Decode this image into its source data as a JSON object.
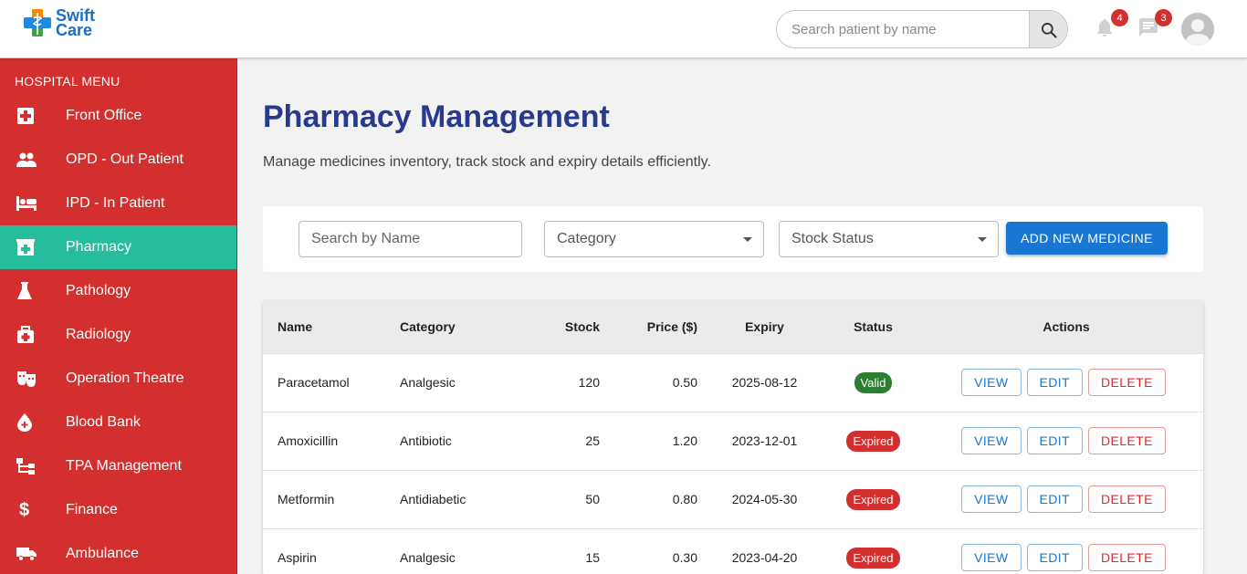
{
  "header": {
    "logo_line1": "Swift",
    "logo_line2": "Care",
    "search_placeholder": "Search patient by name",
    "notifications_count": "4",
    "messages_count": "3"
  },
  "sidebar": {
    "title": "HOSPITAL MENU",
    "items": [
      {
        "label": "Front Office",
        "icon": "first-aid-icon"
      },
      {
        "label": "OPD - Out Patient",
        "icon": "people-icon"
      },
      {
        "label": "IPD - In Patient",
        "icon": "bed-icon"
      },
      {
        "label": "Pharmacy",
        "icon": "pharmacy-icon",
        "active": true
      },
      {
        "label": "Pathology",
        "icon": "flask-icon"
      },
      {
        "label": "Radiology",
        "icon": "medical-bag-icon"
      },
      {
        "label": "Operation Theatre",
        "icon": "theatre-masks-icon"
      },
      {
        "label": "Blood Bank",
        "icon": "blood-drop-icon"
      },
      {
        "label": "TPA Management",
        "icon": "hierarchy-icon"
      },
      {
        "label": "Finance",
        "icon": "dollar-icon"
      },
      {
        "label": "Ambulance",
        "icon": "truck-icon"
      }
    ]
  },
  "main": {
    "title": "Pharmacy Management",
    "subtitle": "Manage medicines inventory, track stock and expiry details efficiently.",
    "filters": {
      "name_placeholder": "Search by Name",
      "category_label": "Category",
      "stock_label": "Stock Status",
      "add_button": "ADD NEW MEDICINE"
    },
    "table": {
      "columns": [
        "Name",
        "Category",
        "Stock",
        "Price ($)",
        "Expiry",
        "Status",
        "Actions"
      ],
      "rows": [
        {
          "name": "Paracetamol",
          "category": "Analgesic",
          "stock": "120",
          "price": "0.50",
          "expiry": "2025-08-12",
          "status": "Valid"
        },
        {
          "name": "Amoxicillin",
          "category": "Antibiotic",
          "stock": "25",
          "price": "1.20",
          "expiry": "2023-12-01",
          "status": "Expired"
        },
        {
          "name": "Metformin",
          "category": "Antidiabetic",
          "stock": "50",
          "price": "0.80",
          "expiry": "2024-05-30",
          "status": "Expired"
        },
        {
          "name": "Aspirin",
          "category": "Analgesic",
          "stock": "15",
          "price": "0.30",
          "expiry": "2023-04-20",
          "status": "Expired"
        }
      ],
      "actions": {
        "view": "VIEW",
        "edit": "EDIT",
        "delete": "DELETE"
      }
    }
  },
  "colors": {
    "sidebar_bg": "#d32f2f",
    "active_item": "#26bd9d",
    "title": "#283a8c",
    "primary": "#1976d2",
    "valid": "#2e7d32",
    "expired": "#d32f2f"
  }
}
